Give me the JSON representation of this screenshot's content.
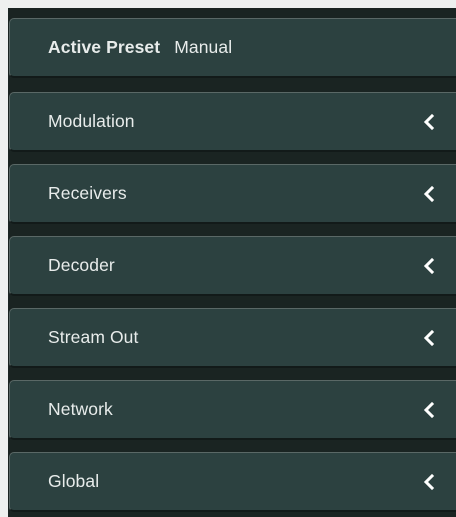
{
  "preset": {
    "label": "Active Preset",
    "value": "Manual"
  },
  "sections": [
    {
      "label": "Modulation",
      "icon": "chevron-left-icon"
    },
    {
      "label": "Receivers",
      "icon": "chevron-left-icon"
    },
    {
      "label": "Decoder",
      "icon": "chevron-left-icon"
    },
    {
      "label": "Stream Out",
      "icon": "chevron-left-icon"
    },
    {
      "label": "Network",
      "icon": "chevron-left-icon"
    },
    {
      "label": "Global",
      "icon": "chevron-left-icon"
    }
  ],
  "colors": {
    "panel": "#2c4140",
    "text": "#e8eceb",
    "frame": "#1a2422"
  }
}
